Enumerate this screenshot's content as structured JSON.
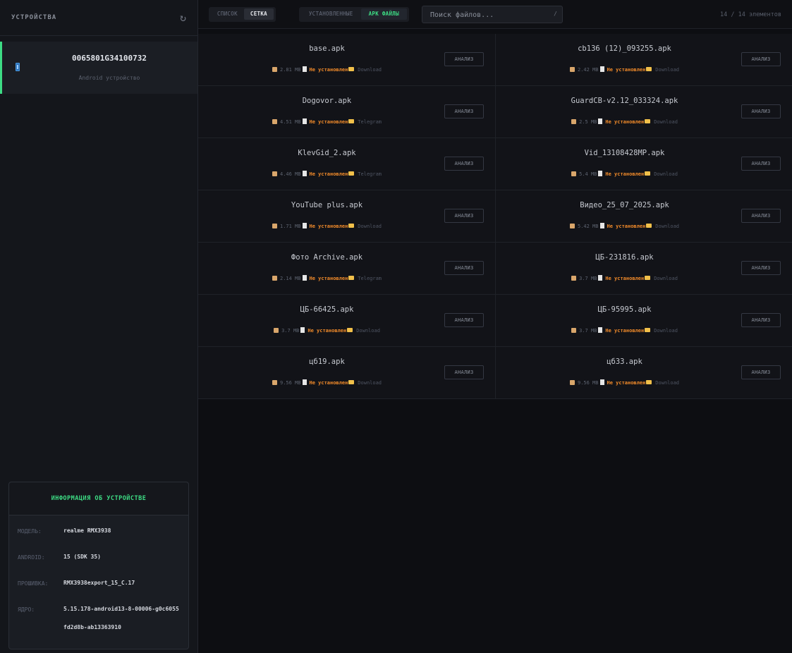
{
  "sidebar": {
    "title": "УСТРОЙСТВА",
    "refresh_icon": "refresh-icon",
    "device": {
      "serial": "0065801G34100732",
      "subtitle": "Android устройство"
    },
    "info": {
      "title": "ИНФОРМАЦИЯ ОБ УСТРОЙСТВЕ",
      "rows": [
        {
          "key": "МОДЕЛЬ:",
          "value": "realme RMX3938"
        },
        {
          "key": "ANDROID:",
          "value": "15 (SDK 35)"
        },
        {
          "key": "ПРОШИВКА:",
          "value": "RMX3938export_15_C.17"
        },
        {
          "key": "ЯДРО:",
          "value": "5.15.178-android13-8-00006-g0c6055fd2d8b-ab13363910"
        }
      ]
    }
  },
  "toolbar": {
    "view_list": "СПИСОК",
    "view_grid": "СЕТКА",
    "filter_installed": "УСТАНОВЛЕННЫЕ",
    "filter_apk": "APK ФАЙЛЫ",
    "search_placeholder": "Поиск файлов...",
    "search_shortcut": "/",
    "count": "14 / 14 элементов"
  },
  "analyze_label": "АНАЛИЗ",
  "files": [
    {
      "name": "base.apk",
      "size": "2.81 MB",
      "status": "Не установлен",
      "source": "Download"
    },
    {
      "name": "cb136 (12)_093255.apk",
      "size": "2.42 MB",
      "status": "Не установлен",
      "source": "Download"
    },
    {
      "name": "Dogovor.apk",
      "size": "4.51 MB",
      "status": "Не установлен",
      "source": "Telegram"
    },
    {
      "name": "GuardCB-v2.12_033324.apk",
      "size": "2.5 MB",
      "status": "Не установлен",
      "source": "Download"
    },
    {
      "name": "KlevGid_2.apk",
      "size": "4.46 MB",
      "status": "Не установлен",
      "source": "Telegram"
    },
    {
      "name": "Vid_13108428MP.apk",
      "size": "5.4 MB",
      "status": "Не установлен",
      "source": "Download"
    },
    {
      "name": "YouTube plus.apk",
      "size": "1.71 MB",
      "status": "Не установлен",
      "source": "Download"
    },
    {
      "name": "Видео_25_07_2025.apk",
      "size": "5.42 MB",
      "status": "Не установлен",
      "source": "Download"
    },
    {
      "name": "Фото Archive.apk",
      "size": "2.14 MB",
      "status": "Не установлен",
      "source": "Telegram"
    },
    {
      "name": "ЦБ-231816.apk",
      "size": "3.7 MB",
      "status": "Не установлен",
      "source": "Download"
    },
    {
      "name": "ЦБ-66425.apk",
      "size": "3.7 MB",
      "status": "Не установлен",
      "source": "Download"
    },
    {
      "name": "ЦБ-95995.apk",
      "size": "3.7 MB",
      "status": "Не установлен",
      "source": "Download"
    },
    {
      "name": "цб19.apk",
      "size": "9.56 MB",
      "status": "Не установлен",
      "source": "Download"
    },
    {
      "name": "цб33.apk",
      "size": "9.56 MB",
      "status": "Не установлен",
      "source": "Download"
    }
  ]
}
